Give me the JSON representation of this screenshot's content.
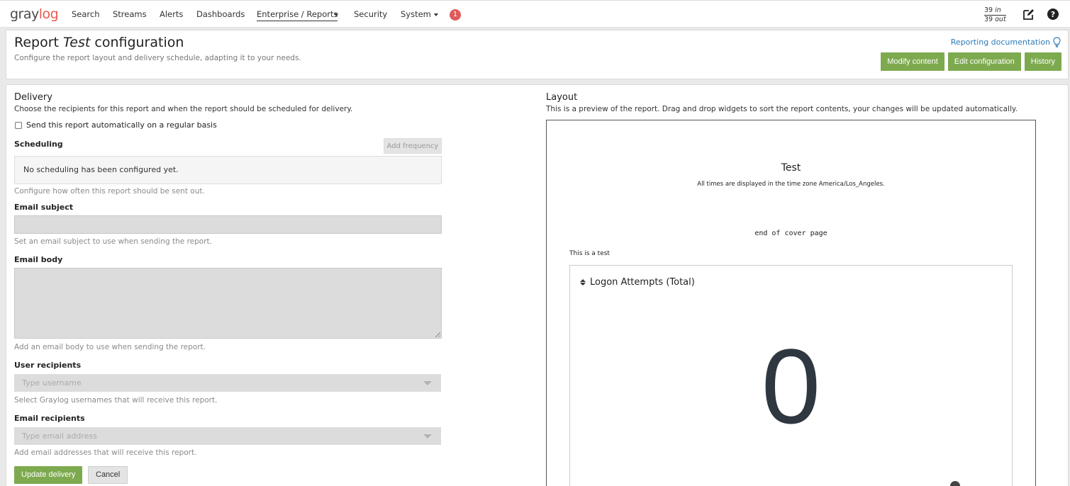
{
  "nav": {
    "logo_part1": "gray",
    "logo_part2": "log",
    "items": [
      "Search",
      "Streams",
      "Alerts",
      "Dashboards",
      "Enterprise / Reports",
      "Security",
      "System"
    ],
    "notifications": "1",
    "throughput_in_count": "39",
    "throughput_in_label": "in",
    "throughput_out_count": "39",
    "throughput_out_label": "out"
  },
  "header": {
    "title_prefix": "Report",
    "title_name": "Test",
    "title_suffix": "configuration",
    "subtitle": "Configure the report layout and delivery schedule, adapting it to your needs.",
    "doc_link": "Reporting documentation",
    "buttons": [
      "Modify content",
      "Edit configuration",
      "History"
    ]
  },
  "delivery": {
    "title": "Delivery",
    "description": "Choose the recipients for this report and when the report should be scheduled for delivery.",
    "auto_send_label": "Send this report automatically on a regular basis",
    "scheduling_label": "Scheduling",
    "add_frequency": "Add frequency",
    "no_schedule": "No scheduling has been configured yet.",
    "scheduling_help": "Configure how often this report should be sent out.",
    "email_subject_label": "Email subject",
    "email_subject_value": "",
    "email_subject_help": "Set an email subject to use when sending the report.",
    "email_body_label": "Email body",
    "email_body_value": "",
    "email_body_help": "Add an email body to use when sending the report.",
    "user_recipients_label": "User recipients",
    "user_recipients_placeholder": "Type username",
    "user_recipients_help": "Select Graylog usernames that will receive this report.",
    "email_recipients_label": "Email recipients",
    "email_recipients_placeholder": "Type email address",
    "email_recipients_help": "Add email addresses that will receive this report.",
    "update_button": "Update delivery",
    "cancel_button": "Cancel"
  },
  "layout": {
    "title": "Layout",
    "description": "This is a preview of the report. Drag and drop widgets to sort the report contents, your changes will be updated automatically.",
    "preview_title": "Test",
    "preview_timezone": "All times are displayed in the time zone America/Los_Angeles.",
    "cover_end": "end of cover page",
    "report_description": "This is a test",
    "widget_title": "Logon Attempts (Total)",
    "widget_value": "0"
  },
  "colors": {
    "accent_green": "#7daa4f",
    "logo_red": "#ea5a4f",
    "link_blue": "#2d7bb8",
    "badge_red": "#e05a5a"
  }
}
